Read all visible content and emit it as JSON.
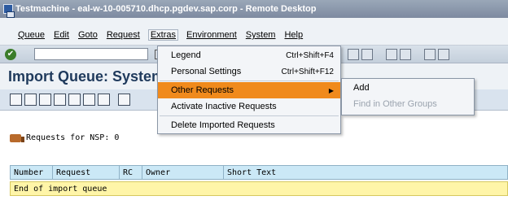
{
  "window": {
    "title": "Testmachine - eal-w-10-005710.dhcp.pgdev.sap.corp - Remote Desktop"
  },
  "menubar": {
    "items": [
      "Queue",
      "Edit",
      "Goto",
      "Request",
      "Extras",
      "Environment",
      "System",
      "Help"
    ],
    "active": "Extras"
  },
  "page": {
    "title": "Import Queue: System"
  },
  "content": {
    "requests_label": "Requests for NSP: 0"
  },
  "grid": {
    "columns": [
      "Number",
      "Request",
      "RC",
      "Owner",
      "Short Text"
    ],
    "rows": [
      "End of import queue"
    ]
  },
  "extras_menu": {
    "items": [
      {
        "label": "Legend",
        "shortcut": "Ctrl+Shift+F4"
      },
      {
        "label": "Personal Settings",
        "shortcut": "Ctrl+Shift+F12"
      },
      {
        "label": "Other Requests",
        "shortcut": ""
      },
      {
        "label": "Activate Inactive Requests",
        "shortcut": ""
      },
      {
        "label": "Delete Imported Requests",
        "shortcut": ""
      }
    ],
    "highlighted": "Other Requests"
  },
  "submenu": {
    "items": [
      {
        "label": "Add",
        "enabled": true
      },
      {
        "label": "Find in Other Groups",
        "enabled": false
      }
    ]
  },
  "colors": {
    "highlight": "#f08a1c",
    "grid_header": "#cbe8f6",
    "grid_row": "#fff5a8"
  }
}
